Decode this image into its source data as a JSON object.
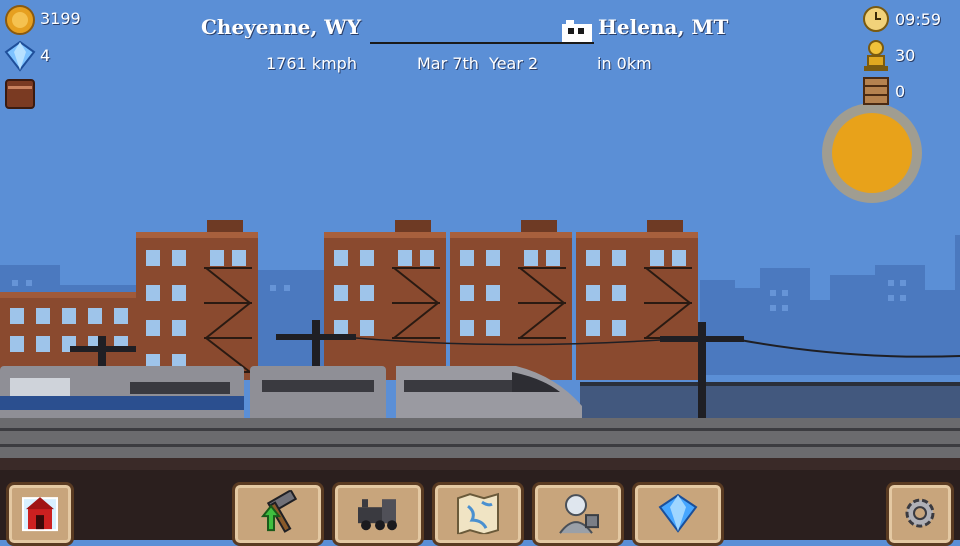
{
  "currency": {
    "coins": "3199",
    "gems": "4"
  },
  "route": {
    "origin": "Cheyenne, WY",
    "destination": "Helena, MT",
    "speed": "1761 kmph",
    "date": "Mar 7th  Year 2",
    "distance": "in 0km",
    "progress": 1.0
  },
  "status": {
    "time": "09:59",
    "passengers": "30",
    "cargo": "0"
  },
  "icons": {
    "coin": "coin-icon",
    "gem": "gem-icon",
    "book": "book-icon",
    "clock": "clock-icon",
    "passenger": "passenger-icon",
    "crate": "crate-icon",
    "train": "train-icon",
    "sun": "sun-icon"
  },
  "colors": {
    "sky": "#5b8fd6",
    "brick": "#8a4a2f",
    "sun": "#e8a21a",
    "button": "#c8a57c"
  }
}
